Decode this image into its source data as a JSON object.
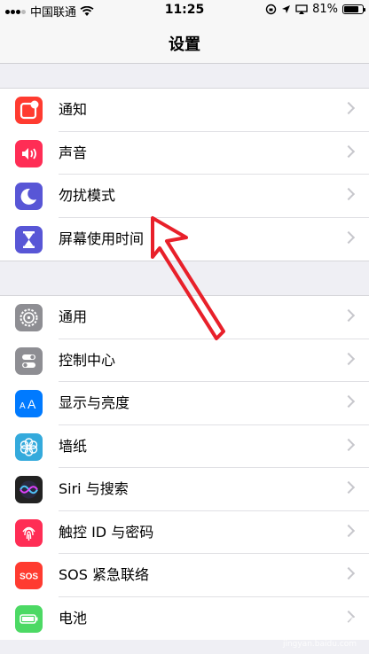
{
  "status_bar": {
    "carrier": "中国联通",
    "time": "11:25",
    "battery": "81%",
    "battery_level": 0.81,
    "signal_icon": "signal-dots-icon",
    "wifi_icon": "wifi-icon"
  },
  "nav": {
    "title": "设置"
  },
  "groups": [
    {
      "items": [
        {
          "label": "通知",
          "icon": "notifications-icon",
          "color": "#ff3b30"
        },
        {
          "label": "声音",
          "icon": "sounds-icon",
          "color": "#ff2d55"
        },
        {
          "label": "勿扰模式",
          "icon": "moon-icon",
          "color": "#5856d6"
        },
        {
          "label": "屏幕使用时间",
          "icon": "hourglass-icon",
          "color": "#5856d6"
        }
      ]
    },
    {
      "items": [
        {
          "label": "通用",
          "icon": "gear-icon",
          "color": "#8e8e93"
        },
        {
          "label": "控制中心",
          "icon": "control-center-icon",
          "color": "#8e8e93"
        },
        {
          "label": "显示与亮度",
          "icon": "display-brightness-icon",
          "color": "#007aff"
        },
        {
          "label": "墙纸",
          "icon": "wallpaper-icon",
          "color": "#34aadc"
        },
        {
          "label": "Siri 与搜索",
          "icon": "siri-icon",
          "color": "#222222"
        },
        {
          "label": "触控 ID 与密码",
          "icon": "fingerprint-icon",
          "color": "#ff2d55"
        },
        {
          "label": "SOS 紧急联络",
          "icon": "sos-icon",
          "color": "#ff3b30"
        },
        {
          "label": "电池",
          "icon": "battery-icon",
          "color": "#4cd964"
        }
      ]
    }
  ],
  "annotation": {
    "color": "#e8202a"
  },
  "watermark": {
    "text": "Baidu 经验",
    "sub": "jingyan.baidu.com"
  }
}
